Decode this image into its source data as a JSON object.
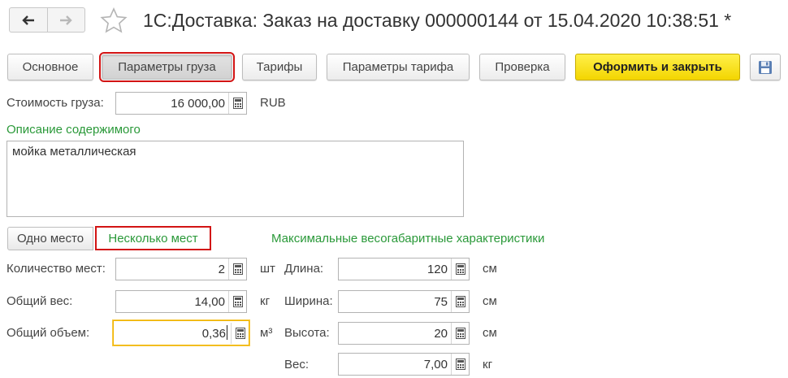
{
  "window": {
    "title": "1С:Доставка: Заказ на доставку 000000144 от 15.04.2020 10:38:51 *",
    "back_icon": "arrow-left-icon",
    "forward_icon": "arrow-right-icon",
    "favorite_icon": "star-icon"
  },
  "toolbar": {
    "tabs": [
      "Основное",
      "Параметры груза",
      "Тарифы",
      "Параметры тарифа",
      "Проверка"
    ],
    "active_tab": "Параметры груза",
    "submit_label": "Оформить и закрыть",
    "save_icon": "floppy-disk-icon"
  },
  "cargo": {
    "cost_label": "Стоимость груза:",
    "cost_value": "16 000,00",
    "currency": "RUB",
    "description_label": "Описание содержимого",
    "description_value": "мойка металлическая"
  },
  "places": {
    "single_label": "Одно место",
    "multiple_label": "Несколько мест",
    "selected": "Несколько мест",
    "max_header": "Максимальные весогабаритные характеристики",
    "count_label": "Количество мест:",
    "count_value": "2",
    "count_unit": "шт",
    "weight_label": "Общий вес:",
    "weight_value": "14,00",
    "weight_unit": "кг",
    "volume_label": "Общий объем:",
    "volume_value": "0,36",
    "volume_unit": "м³"
  },
  "dimensions": {
    "length_label": "Длина:",
    "length_value": "120",
    "length_unit": "см",
    "width_label": "Ширина:",
    "width_value": "75",
    "width_unit": "см",
    "height_label": "Высота:",
    "height_value": "20",
    "height_unit": "см",
    "weight_label": "Вес:",
    "weight_value": "7,00",
    "weight_unit": "кг"
  },
  "colors": {
    "accent_green": "#2a9939",
    "highlight_red": "#d21414",
    "primary_yellow": "#f3d500",
    "focus_orange": "#f0b400"
  }
}
